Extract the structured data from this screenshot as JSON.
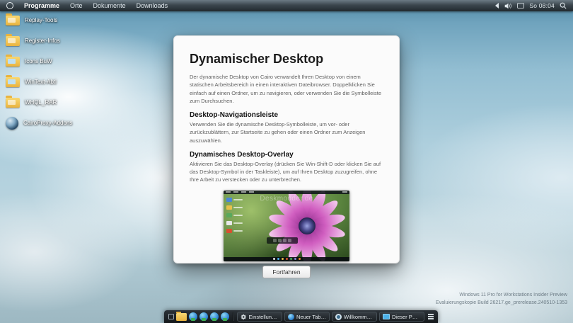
{
  "topbar": {
    "menu_icon": "cairo-menu-icon",
    "menus": [
      {
        "label": "Programme"
      },
      {
        "label": "Orte"
      },
      {
        "label": "Dokumente"
      },
      {
        "label": "Downloads"
      }
    ],
    "tray": {
      "icons": [
        "tray-expander-icon",
        "volume-icon",
        "keyboard-layout-icon"
      ],
      "clock": "So 08:04",
      "search_icon": "search-icon"
    }
  },
  "desktop": {
    "icons": [
      {
        "label": "Replay-Tools",
        "icon": "folder-icon"
      },
      {
        "label": "Register-Infos",
        "icon": "folder-icon"
      },
      {
        "label": "Icons BuW",
        "icon": "folder-icon"
      },
      {
        "label": "WinText-Abtl",
        "icon": "folder-icon"
      },
      {
        "label": "WHQL_RAR",
        "icon": "folder-icon"
      },
      {
        "label": "CairoProxy-Addons",
        "icon": "cairo-ring-icon"
      }
    ]
  },
  "dialog": {
    "title": "Dynamischer Desktop",
    "intro": "Der dynamische Desktop von Cairo verwandelt Ihren Desktop von einem statischen Arbeitsbereich in einen interaktiven Dateibrowser. Doppelklicken Sie einfach auf einen Ordner, um zu navigieren, oder verwenden Sie die Symbolleiste zum Durchsuchen.",
    "sections": [
      {
        "heading": "Desktop-Navigationsleiste",
        "body": "Verwenden Sie die dynamische Desktop-Symbolleiste, um vor- oder zurückzublättern, zur Startseite zu gehen oder einen Ordner zum Anzeigen auszuwählen."
      },
      {
        "heading": "Dynamisches Desktop-Overlay",
        "body": "Aktivieren Sie das Desktop-Overlay (drücken Sie Win-Shift-D oder klicken Sie auf das Desktop-Symbol in der Taskleiste), um auf Ihren Desktop zuzugreifen, ohne Ihre Arbeit zu verstecken oder zu unterbrechen."
      }
    ],
    "preview": {
      "watermark": "Deskmodder.de",
      "description_icon": "flower-image"
    },
    "continue_label": "Fortfahren"
  },
  "taskbar": {
    "icons": [
      "show-desktop-icon",
      "folder-icon",
      "app-icon",
      "app-icon",
      "app-icon",
      "app-icon"
    ],
    "buttons": [
      {
        "icon": "gear-icon",
        "label": "Einstellungen"
      },
      {
        "icon": "browser-tab-icon",
        "label": "Neuer Tab - Persö…"
      },
      {
        "icon": "welcome-ring-icon",
        "label": "Willkommen zu C…"
      },
      {
        "icon": "computer-icon",
        "label": "Dieser PC - Datei…"
      }
    ],
    "menu_icon": "hamburger-menu-icon"
  },
  "watermark": {
    "line1": "Windows 11 Pro for Workstations Insider Preview",
    "line2": "Evaluierungskopie Build 26217.ge_prerelease.240510-1353"
  },
  "colors": {
    "topbar_bg": "#3b464d",
    "dialog_bg": "#fbfbfb",
    "taskbar_bg": "#1a1e22",
    "folder": "#e9b33e",
    "flower_petal": "#d05ec0",
    "flower_center": "#3c3c72",
    "preview_green": "#3f6128"
  }
}
